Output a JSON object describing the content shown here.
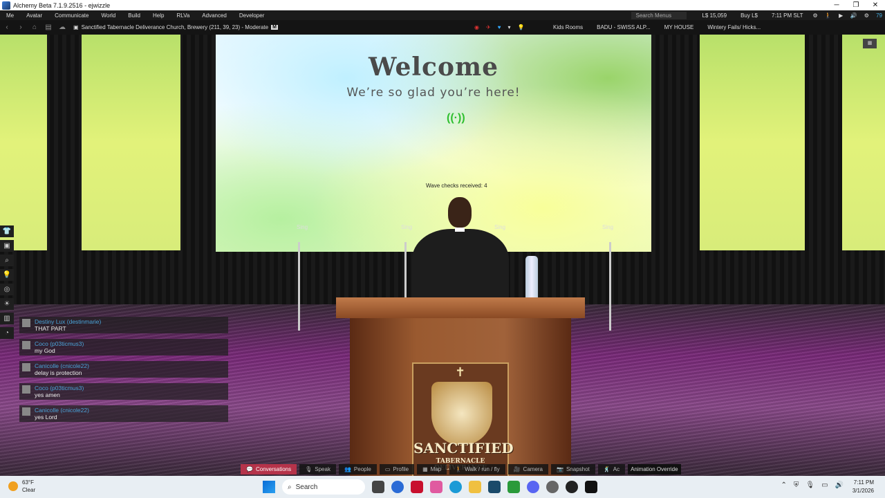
{
  "window": {
    "title": "Alchemy Beta 7.1.9.2516 - ejwizzle",
    "minimize": "─",
    "maximize": "❐",
    "close": "✕"
  },
  "menu": {
    "items": [
      "Me",
      "Avatar",
      "Communicate",
      "World",
      "Build",
      "Help",
      "RLVa",
      "Advanced",
      "Developer"
    ],
    "search_placeholder": "Search Menus",
    "balance": "L$ 15,059",
    "buy": "Buy L$",
    "time": "7:11 PM SLT",
    "status_number": "79"
  },
  "nav": {
    "location": "Sanctified Tabernacle Deliverance Church, Brewery (211, 39, 23) - Moderate",
    "rating_badge": "M",
    "landmarks": [
      "Kids Rooms",
      "BADU - SWISS ALP...",
      "MY HOUSE",
      "Wintery Fails/ Hicks..."
    ]
  },
  "scene": {
    "welcome": "Welcome",
    "glad": "We’re so glad you’re here!",
    "wave_icon": "((·))",
    "wave_checks": "Wave checks received: 4",
    "sing_label": "Sing",
    "emblem_line1": "SANCTIFIED",
    "emblem_line2": "TABERNACLE DELIVERANCE",
    "cross": "✝"
  },
  "chat": [
    {
      "who": "Destiny Lux (destinmarie)",
      "text": "THAT PART"
    },
    {
      "who": "Coco (p03ticmus3)",
      "text": "my God"
    },
    {
      "who": "Canicolle (cnicole22)",
      "text": "delay is protection"
    },
    {
      "who": "Coco (p03ticmus3)",
      "text": "yes amen"
    },
    {
      "who": "Canicolle (cnicole22)",
      "text": "yes Lord"
    }
  ],
  "bottombar": {
    "conversations": "Conversations",
    "speak": "Speak",
    "people": "People",
    "profile": "Profile",
    "map": "Map",
    "walk": "Walk / run / fly",
    "camera": "Camera",
    "snapshot": "Snapshot",
    "ao_short": "Ac",
    "animation_override": "Animation Override"
  },
  "taskbar": {
    "temp": "63°F",
    "condition": "Clear",
    "search": "Search",
    "time": "7:11 PM",
    "date": "3/1/2026"
  },
  "colors": {
    "accent": "#b5334a",
    "chat_name": "#4aa3d8"
  }
}
